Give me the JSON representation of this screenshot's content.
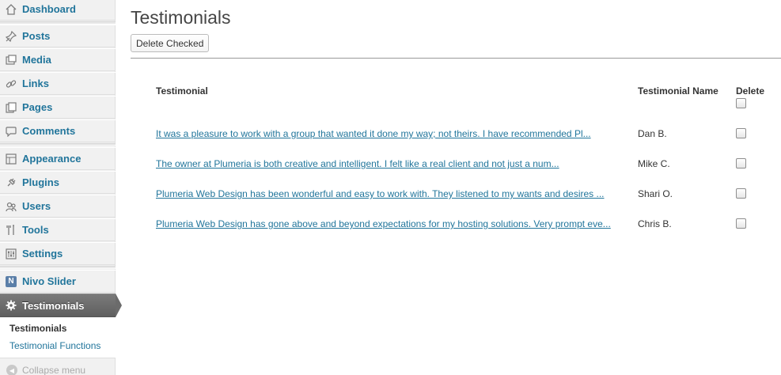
{
  "sidebar": {
    "items": [
      {
        "label": "Dashboard",
        "icon": "home-icon"
      },
      {
        "label": "Posts",
        "icon": "pushpin-icon"
      },
      {
        "label": "Media",
        "icon": "media-icon"
      },
      {
        "label": "Links",
        "icon": "link-icon"
      },
      {
        "label": "Pages",
        "icon": "pages-icon"
      },
      {
        "label": "Comments",
        "icon": "comment-icon"
      },
      {
        "label": "Appearance",
        "icon": "appearance-icon"
      },
      {
        "label": "Plugins",
        "icon": "plugin-icon"
      },
      {
        "label": "Users",
        "icon": "users-icon"
      },
      {
        "label": "Tools",
        "icon": "tools-icon"
      },
      {
        "label": "Settings",
        "icon": "settings-icon"
      },
      {
        "label": "Nivo Slider",
        "icon": "nivo-icon"
      },
      {
        "label": "Testimonials",
        "icon": "gear-icon",
        "active": true
      }
    ],
    "submenu": [
      "Testimonials",
      "Testimonial Functions"
    ],
    "collapse_label": "Collapse menu",
    "nivo_letter": "N"
  },
  "main": {
    "title": "Testimonials",
    "delete_checked_label": "Delete Checked",
    "table": {
      "headers": [
        "Testimonial",
        "Testimonial Name",
        "Delete"
      ],
      "rows": [
        {
          "testimonial": "It was a pleasure to work with a group that wanted it done my way; not theirs. I have recommended Pl...",
          "name": "Dan B."
        },
        {
          "testimonial": "The owner at Plumeria is both creative and intelligent. I felt like a real client and not just a num...",
          "name": "Mike C."
        },
        {
          "testimonial": "Plumeria Web Design has been wonderful and easy to work with. They listened to my wants and desires ...",
          "name": "Shari O."
        },
        {
          "testimonial": "Plumeria Web Design has gone above and beyond expectations for my hosting solutions. Very prompt eve...",
          "name": "Chris B."
        }
      ]
    }
  },
  "colors": {
    "link": "#21759b",
    "active_menu": "#6b6b6b"
  }
}
